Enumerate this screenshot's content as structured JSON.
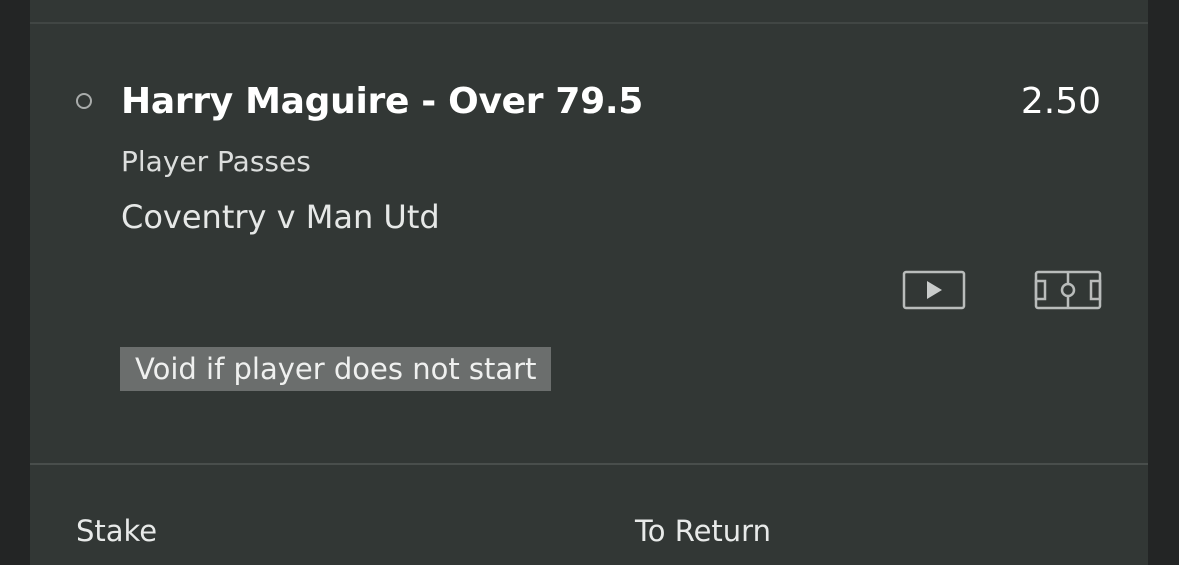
{
  "bet": {
    "selection": "Harry Maguire - Over 79.5",
    "odds": "2.50",
    "market": "Player Passes",
    "event": "Coventry v Man Utd",
    "note": "Void if player does not start"
  },
  "footer": {
    "stake_label": "Stake",
    "return_label": "To Return"
  },
  "icons": {
    "radio": "radio-unselected-icon",
    "video": "play-video-icon",
    "stats": "pitch-stats-icon"
  },
  "colors": {
    "card_background": "#323735",
    "outer_background": "#232525",
    "badge_background": "#6b6e6d",
    "text_primary": "#ffffff"
  }
}
